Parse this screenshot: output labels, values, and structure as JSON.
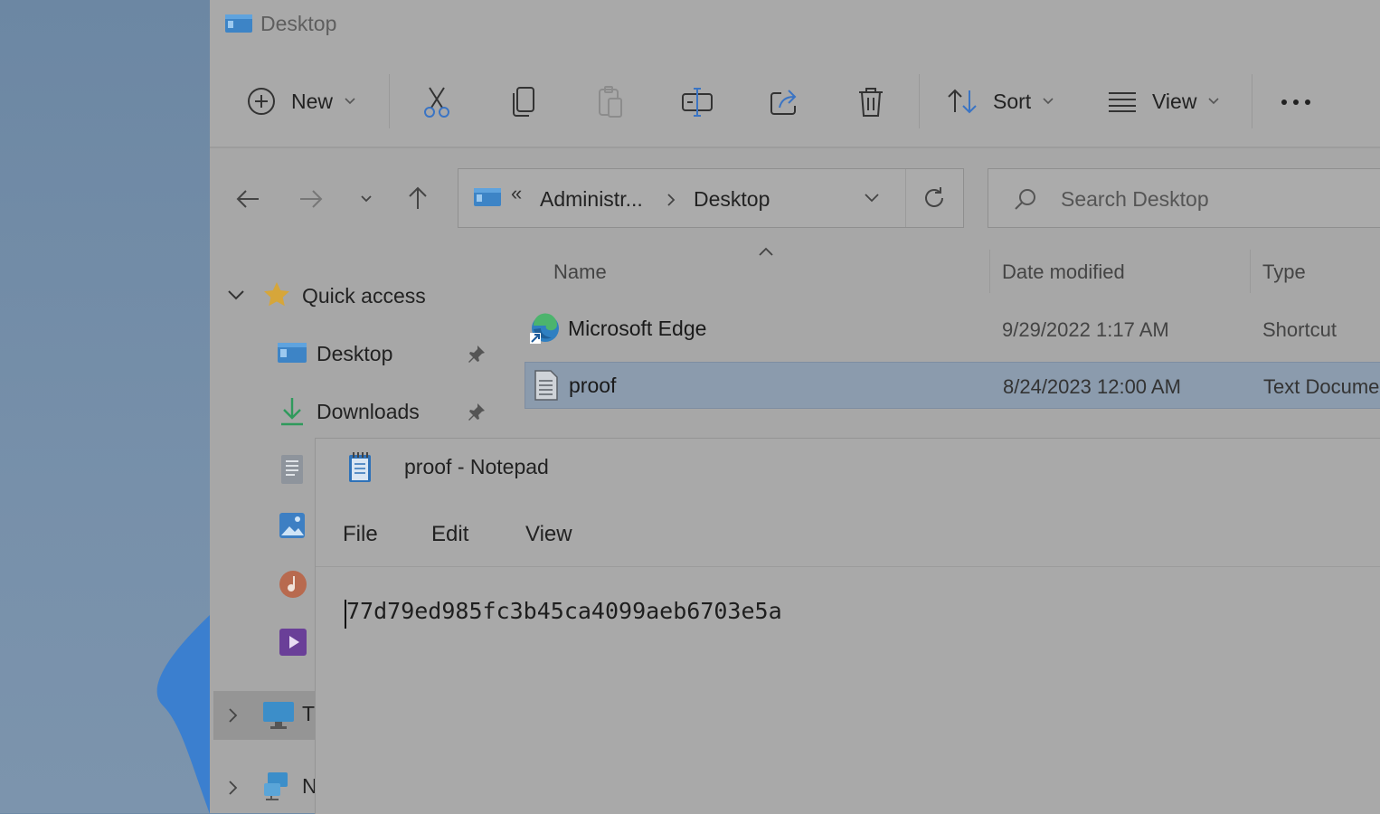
{
  "explorer": {
    "title": "Desktop",
    "toolbar": {
      "new_label": "New",
      "sort_label": "Sort",
      "view_label": "View",
      "more_label": "..."
    },
    "address": {
      "overflow": "«",
      "segments": [
        "Administr...",
        "Desktop"
      ]
    },
    "search": {
      "placeholder": "Search Desktop"
    },
    "nav": {
      "quick_access": "Quick access",
      "items": [
        {
          "label": "Desktop",
          "pinned": true
        },
        {
          "label": "Downloads",
          "pinned": true
        }
      ],
      "this_pc": "Tl",
      "network": "N"
    },
    "columns": {
      "name": "Name",
      "date": "Date modified",
      "type": "Type"
    },
    "files": [
      {
        "name": "Microsoft Edge",
        "date": "9/29/2022 1:17 AM",
        "type": "Shortcut",
        "icon": "edge-icon"
      },
      {
        "name": "proof",
        "date": "8/24/2023 12:00 AM",
        "type": "Text Docume",
        "icon": "text-file-icon",
        "selected": true
      }
    ]
  },
  "notepad": {
    "title": "proof - Notepad",
    "menu": [
      "File",
      "Edit",
      "View"
    ],
    "content": "77d79ed985fc3b45ca4099aeb6703e5a"
  },
  "colors": {
    "selection": "#8b9bad",
    "overlay_dim": "#a9a9a9"
  }
}
